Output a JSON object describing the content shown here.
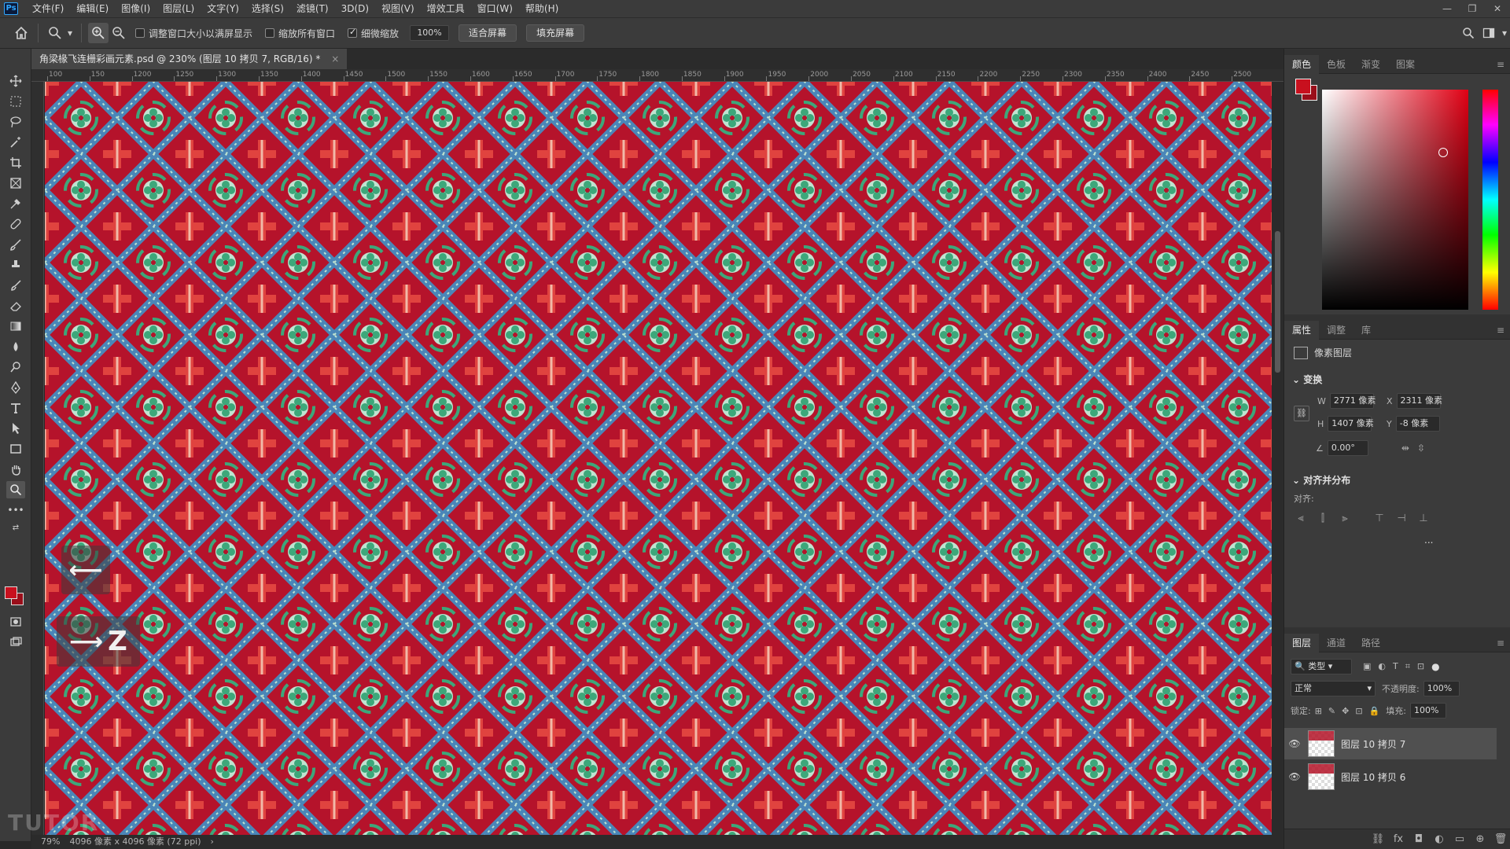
{
  "menu": {
    "logo": "Ps",
    "items": [
      "文件(F)",
      "编辑(E)",
      "图像(I)",
      "图层(L)",
      "文字(Y)",
      "选择(S)",
      "滤镜(T)",
      "3D(D)",
      "视图(V)",
      "增效工具",
      "窗口(W)",
      "帮助(H)"
    ]
  },
  "options": {
    "resize_windows_label": "调整窗口大小以满屏显示",
    "zoom_all_windows_label": "缩放所有窗口",
    "scrubby_zoom_label": "细微缩放",
    "zoom_value": "100%",
    "fit_screen_label": "适合屏幕",
    "fill_screen_label": "填充屏幕"
  },
  "document": {
    "tab_title": "角梁椽飞连栅彩画元素.psd @ 230% (图层 10 拷贝 7, RGB/16) *"
  },
  "ruler_ticks": [
    "100",
    "150",
    "1200",
    "1250",
    "1300",
    "1350",
    "1400",
    "1450",
    "1500",
    "1550",
    "1600",
    "1650",
    "1700",
    "1750",
    "1800",
    "1850",
    "1900",
    "1950",
    "2000",
    "2050",
    "2100",
    "2150",
    "2200",
    "2250",
    "2300",
    "2350",
    "2400",
    "2450",
    "2500"
  ],
  "overlay": {
    "key_z": "Z"
  },
  "status": {
    "zoom": "79%",
    "doc_size": "4096 像素 x 4096 像素 (72 ppi)"
  },
  "color_panel": {
    "tabs": [
      "颜色",
      "色板",
      "渐变",
      "图案"
    ],
    "foreground": "#c8101e",
    "background": "#9a0e1a"
  },
  "properties_panel": {
    "tabs": [
      "属性",
      "调整",
      "库"
    ],
    "layer_type": "像素图层",
    "transform_title": "变换",
    "w_label": "W",
    "w_value": "2771 像素",
    "x_label": "X",
    "x_value": "2311 像素",
    "h_label": "H",
    "h_value": "1407 像素",
    "y_label": "Y",
    "y_value": "-8 像素",
    "angle_value": "0.00°",
    "align_title": "对齐并分布",
    "align_label": "对齐:",
    "more": "..."
  },
  "layers_panel": {
    "tabs": [
      "图层",
      "通道",
      "路径"
    ],
    "filter_kind": "类型",
    "blend_mode": "正常",
    "opacity_label": "不透明度:",
    "opacity_value": "100%",
    "lock_label": "锁定:",
    "fill_label": "填充:",
    "fill_value": "100%",
    "layers": [
      {
        "name": "图层 10 拷贝 7",
        "selected": true
      },
      {
        "name": "图层 10 拷贝 6",
        "selected": false
      }
    ]
  },
  "pattern_colors": {
    "ground": "#b5132b",
    "blue": "#4a86b8",
    "green": "#3da77a",
    "pale_green": "#bfe3d0",
    "cross_red": "#e0433f",
    "cross_light": "#f1b9a8"
  }
}
